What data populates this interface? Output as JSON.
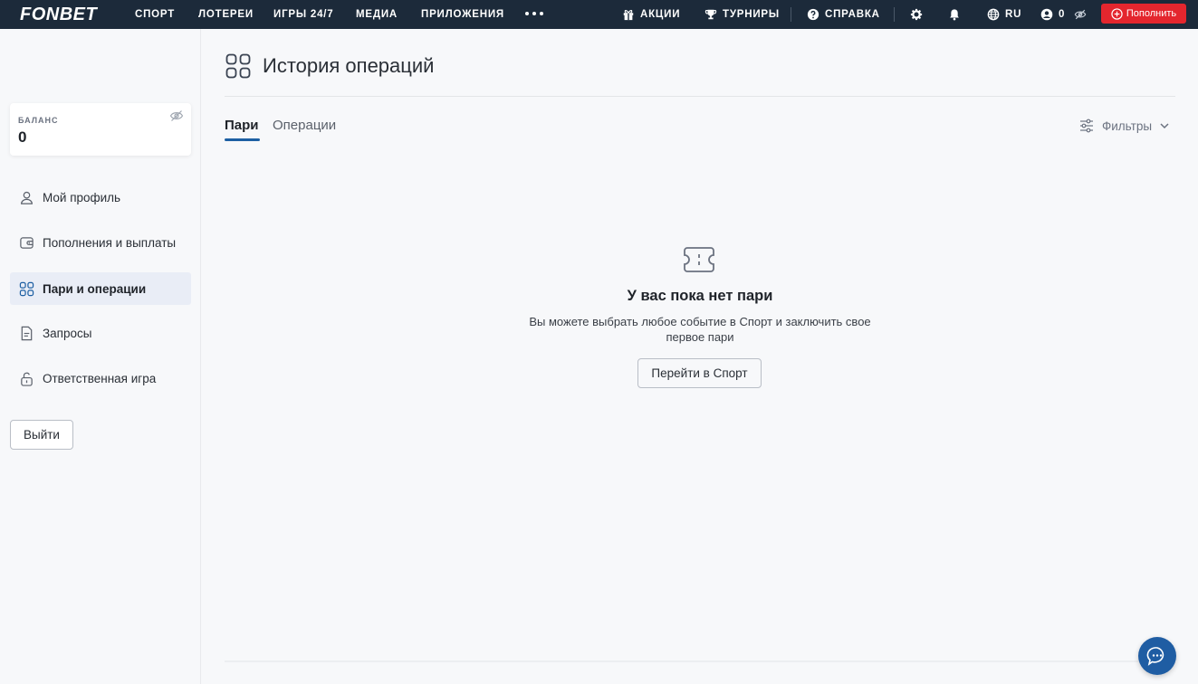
{
  "header": {
    "logo": "FONBET",
    "nav": [
      "СПОРТ",
      "ЛОТЕРЕИ",
      "ИГРЫ 24/7",
      "МЕДИА",
      "ПРИЛОЖЕНИЯ"
    ],
    "promotions": "АКЦИИ",
    "tournaments": "ТУРНИРЫ",
    "help": "СПРАВКА",
    "language": "RU",
    "account_balance": "0",
    "deposit_label": "Пополнить"
  },
  "sidebar": {
    "balance_label": "БАЛАНС",
    "balance_value": "0",
    "items": [
      {
        "label": "Мой профиль",
        "icon": "user-icon"
      },
      {
        "label": "Пополнения и выплаты",
        "icon": "wallet-icon"
      },
      {
        "label": "Пари и операции",
        "icon": "grid-icon",
        "active": true
      },
      {
        "label": "Запросы",
        "icon": "document-icon"
      },
      {
        "label": "Ответственная игра",
        "icon": "lock-icon"
      }
    ],
    "logout_label": "Выйти"
  },
  "main": {
    "title": "История операций",
    "tabs": [
      {
        "label": "Пари",
        "active": true
      },
      {
        "label": "Операции",
        "active": false
      }
    ],
    "filters_label": "Фильтры",
    "empty_title": "У вас пока нет пари",
    "empty_text": "Вы можете выбрать любое событие в Спорт и заключить свое первое пари",
    "go_sport_label": "Перейти в Спорт"
  },
  "colors": {
    "topbar": "#1c2a3a",
    "deposit": "#e4262e",
    "accent": "#1d5fa3",
    "chat": "#1f5da3"
  }
}
